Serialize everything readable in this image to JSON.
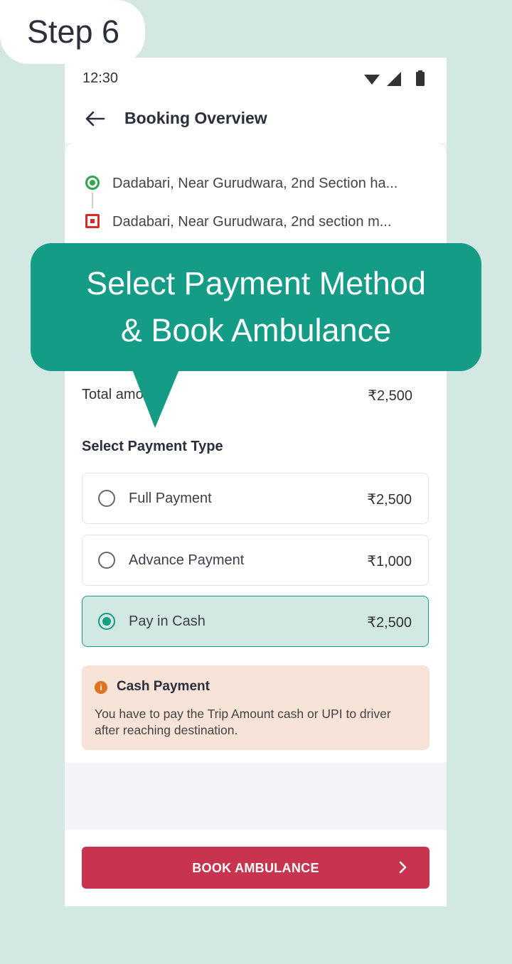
{
  "step_tag": "Step 6",
  "status_bar": {
    "time": "12:30"
  },
  "header": {
    "title": "Booking Overview"
  },
  "route": {
    "pickup": "Dadabari, Near Gurudwara, 2nd Section ha...",
    "drop": "Dadabari, Near Gurudwara, 2nd section m..."
  },
  "total": {
    "label": "Total amount",
    "value": "₹2,500"
  },
  "payment": {
    "title": "Select Payment Type",
    "options": [
      {
        "label": "Full Payment",
        "value": "₹2,500",
        "selected": false
      },
      {
        "label": "Advance Payment",
        "value": "₹1,000",
        "selected": false
      },
      {
        "label": "Pay in Cash",
        "value": "₹2,500",
        "selected": true
      }
    ]
  },
  "cash_note": {
    "title": "Cash Payment",
    "text": "You have to pay the Trip Amount cash or UPI to driver after reaching destination."
  },
  "book_button": {
    "label": "BOOK AMBULANCE"
  },
  "callout": {
    "line1": "Select Payment Method",
    "line2": "& Book Ambulance"
  },
  "colors": {
    "background": "#d3e7e3",
    "accent_teal": "#159c87",
    "book_button": "#c8334f",
    "cash_note_bg": "#f8e3d8",
    "pickup_green": "#2ea84a",
    "drop_red": "#d92b2b"
  },
  "icons": [
    "back-arrow-icon",
    "wifi-icon",
    "signal-icon",
    "battery-icon",
    "pickup-marker-icon",
    "drop-marker-icon",
    "info-icon",
    "chevron-right-icon"
  ]
}
